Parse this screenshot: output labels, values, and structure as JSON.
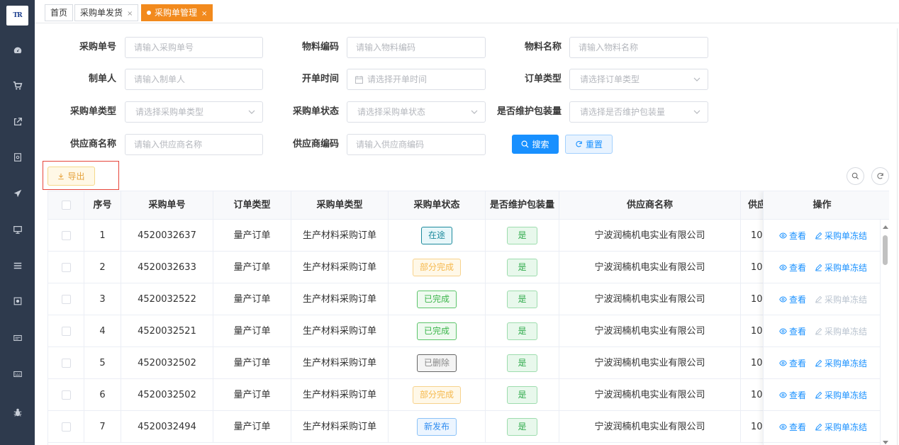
{
  "logo": {
    "text": "TR"
  },
  "sidebar": {
    "icons": [
      "dashboard-icon",
      "cart-icon",
      "external-link-icon",
      "document-icon",
      "send-icon",
      "monitor-icon",
      "list-icon",
      "record-icon",
      "card-icon",
      "keyboard-icon",
      "bug-icon"
    ]
  },
  "tabs": [
    {
      "label": "首页"
    },
    {
      "label": "采购单发货",
      "close": "×"
    },
    {
      "label": "采购单管理",
      "close": "×"
    }
  ],
  "form": {
    "po_no": {
      "label": "采购单号",
      "placeholder": "请输入采购单号"
    },
    "material_code": {
      "label": "物料编码",
      "placeholder": "请输入物料编码"
    },
    "material_name": {
      "label": "物料名称",
      "placeholder": "请输入物料名称"
    },
    "creator": {
      "label": "制单人",
      "placeholder": "请输入制单人"
    },
    "open_time": {
      "label": "开单时间",
      "placeholder": "请选择开单时间"
    },
    "order_type": {
      "label": "订单类型",
      "placeholder": "请选择订单类型"
    },
    "po_type": {
      "label": "采购单类型",
      "placeholder": "请选择采购单类型"
    },
    "po_status": {
      "label": "采购单状态",
      "placeholder": "请选择采购单状态"
    },
    "pkg_maintained": {
      "label": "是否维护包装量",
      "placeholder": "请选择是否维护包装量"
    },
    "supplier_name": {
      "label": "供应商名称",
      "placeholder": "请输入供应商名称"
    },
    "supplier_code": {
      "label": "供应商编码",
      "placeholder": "请输入供应商编码"
    },
    "search_label": "搜索",
    "reset_label": "重置",
    "export_label": "导出"
  },
  "table": {
    "headers": {
      "index": "序号",
      "po_no": "采购单号",
      "order_type": "订单类型",
      "po_type": "采购单类型",
      "status": "采购单状态",
      "pkg": "是否维护包装量",
      "supplier": "供应商名称",
      "supplier_code": "供应",
      "ops": "操作"
    },
    "rows": [
      {
        "index": "1",
        "po_no": "4520032637",
        "order_type": "量产订单",
        "po_type": "生产材料采购订单",
        "status": "在途",
        "status_kind": "transit",
        "pkg": "是",
        "supplier": "宁波润楠机电实业有限公司",
        "code": "10",
        "freeze_enabled": true
      },
      {
        "index": "2",
        "po_no": "4520032633",
        "order_type": "量产订单",
        "po_type": "生产材料采购订单",
        "status": "部分完成",
        "status_kind": "partial",
        "pkg": "是",
        "supplier": "宁波润楠机电实业有限公司",
        "code": "10",
        "freeze_enabled": true
      },
      {
        "index": "3",
        "po_no": "4520032522",
        "order_type": "量产订单",
        "po_type": "生产材料采购订单",
        "status": "已完成",
        "status_kind": "done",
        "pkg": "是",
        "supplier": "宁波润楠机电实业有限公司",
        "code": "10",
        "freeze_enabled": false
      },
      {
        "index": "4",
        "po_no": "4520032521",
        "order_type": "量产订单",
        "po_type": "生产材料采购订单",
        "status": "已完成",
        "status_kind": "done",
        "pkg": "是",
        "supplier": "宁波润楠机电实业有限公司",
        "code": "10",
        "freeze_enabled": false
      },
      {
        "index": "5",
        "po_no": "4520032502",
        "order_type": "量产订单",
        "po_type": "生产材料采购订单",
        "status": "已删除",
        "status_kind": "deleted",
        "pkg": "是",
        "supplier": "宁波润楠机电实业有限公司",
        "code": "10",
        "freeze_enabled": true
      },
      {
        "index": "6",
        "po_no": "4520032502",
        "order_type": "量产订单",
        "po_type": "生产材料采购订单",
        "status": "部分完成",
        "status_kind": "partial",
        "pkg": "是",
        "supplier": "宁波润楠机电实业有限公司",
        "code": "10",
        "freeze_enabled": true
      },
      {
        "index": "7",
        "po_no": "4520032494",
        "order_type": "量产订单",
        "po_type": "生产材料采购订单",
        "status": "新发布",
        "status_kind": "new",
        "pkg": "是",
        "supplier": "宁波润楠机电实业有限公司",
        "code": "10",
        "freeze_enabled": true
      }
    ],
    "view_label": "查看",
    "freeze_label": "采购单冻结"
  }
}
